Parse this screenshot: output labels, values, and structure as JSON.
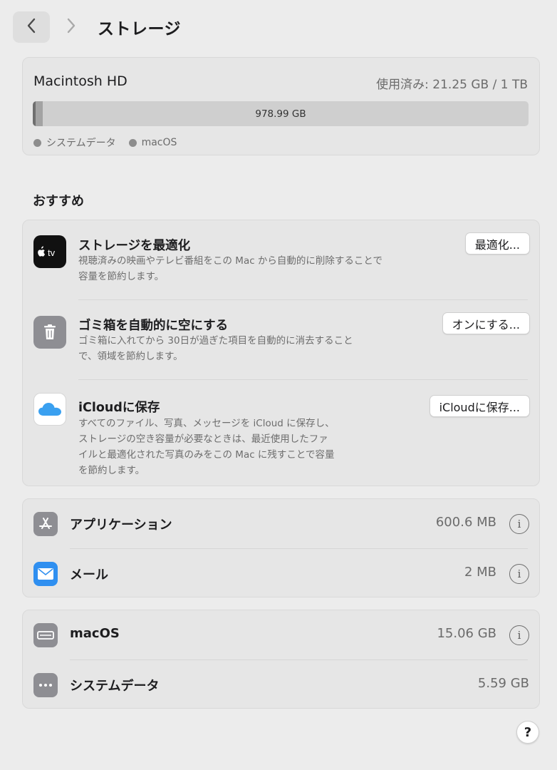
{
  "header": {
    "title": "ストレージ",
    "back_icon": "chevron-left-icon",
    "forward_icon": "chevron-right-icon"
  },
  "disk": {
    "name": "Macintosh HD",
    "usage": "使用済み: 21.25 GB / 1 TB",
    "bar_label": "978.99 GB",
    "used_fraction_system": 0.006,
    "used_fraction_macos": 0.015,
    "legend": [
      {
        "label": "システムデータ",
        "color": "#6f6f6f"
      },
      {
        "label": "macOS",
        "color": "#a3a3a3"
      }
    ]
  },
  "recommendations": {
    "heading": "おすすめ",
    "items": [
      {
        "icon": "apple-tv-icon",
        "title": "ストレージを最適化",
        "desc_lines": [
          "視聴済みの映画やテレビ番組をこの Mac から自動的に削除することで",
          "容量を節約します。"
        ],
        "button": "最適化..."
      },
      {
        "icon": "trash-icon",
        "title": "ゴミ箱を自動的に空にする",
        "desc_lines": [
          "ゴミ箱に入れてから 30日が過ぎた項目を自動的に消去すること",
          "で、領域を節約します。"
        ],
        "button": "オンにする..."
      },
      {
        "icon": "icloud-icon",
        "title": "iCloudに保存",
        "desc_lines": [
          "すべてのファイル、写真、メッセージを iCloud に保存し、",
          "ストレージの空き容量が必要なときは、最近使用したファ",
          "イルと最適化された写真のみをこの Mac に残すことで容量",
          "を節約します。"
        ],
        "button": "iCloudに保存..."
      }
    ]
  },
  "categories_1": [
    {
      "icon": "app-store-icon",
      "label": "アプリケーション",
      "size": "600.6 MB",
      "info": "i"
    },
    {
      "icon": "mail-icon",
      "label": "メール",
      "size": "2 MB",
      "info": "i"
    }
  ],
  "categories_2": [
    {
      "icon": "drive-icon",
      "label": "macOS",
      "size": "15.06 GB",
      "info": "i"
    },
    {
      "icon": "ellipsis-icon",
      "label": "システムデータ",
      "size": "5.59 GB"
    }
  ],
  "help_label": "?",
  "atv_text": "tv",
  "colors": {
    "background": "#ececec",
    "card": "#e6e6e6",
    "icloud_blue": "#3aa0f0",
    "mail_blue": "#2f8ff0"
  }
}
